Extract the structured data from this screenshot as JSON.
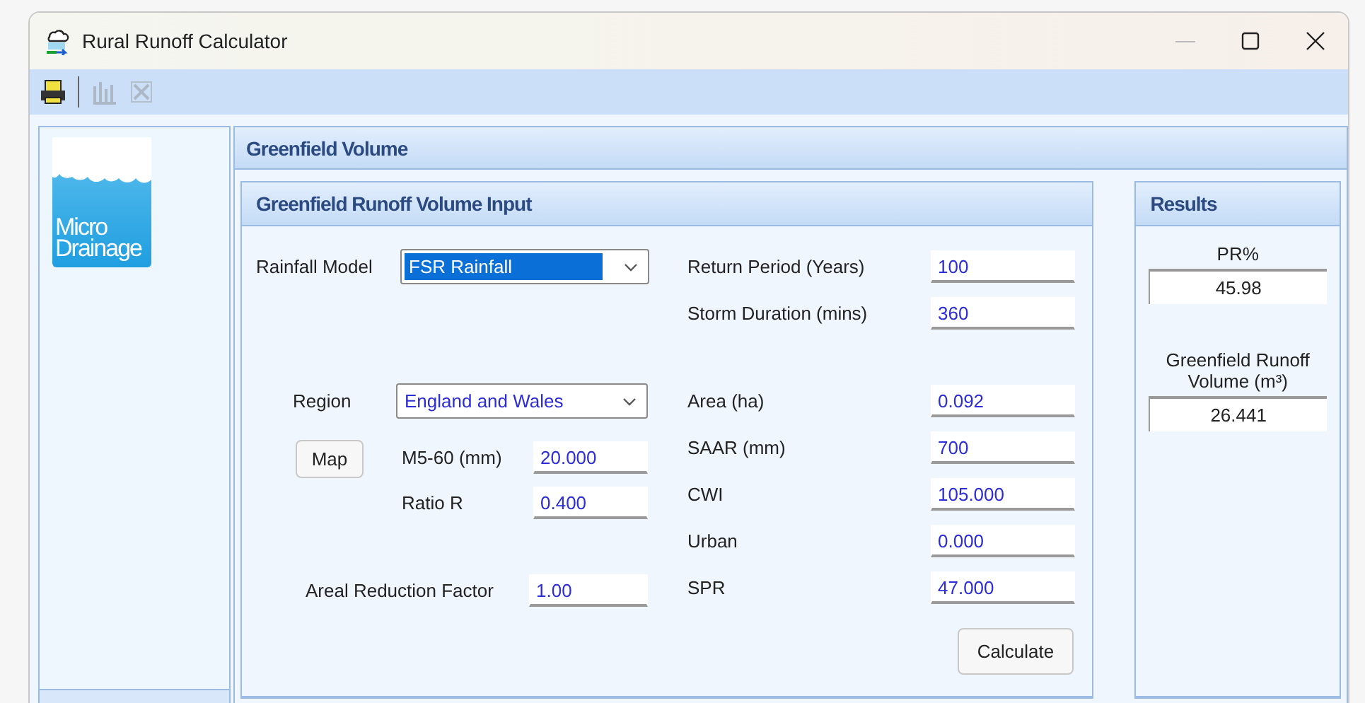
{
  "window": {
    "title": "Rural Runoff Calculator"
  },
  "toolbar": [
    {
      "kind": "printer",
      "disabled": false
    },
    {
      "kind": "chart",
      "disabled": true
    },
    {
      "kind": "delete",
      "disabled": true
    }
  ],
  "sidebar": {
    "logo_lines": [
      "Micro",
      "Drainage"
    ]
  },
  "section_title": "Greenfield Volume",
  "input_panel": {
    "title": "Greenfield Runoff Volume Input",
    "rainfall_model": {
      "label": "Rainfall Model",
      "value": "FSR Rainfall",
      "selected": true
    },
    "region": {
      "label": "Region",
      "value": "England and Wales",
      "selected": false
    },
    "map_button": "Map",
    "rainfall_fields": [
      {
        "label": "M5-60 (mm)",
        "value": "20.000"
      },
      {
        "label": "Ratio R",
        "value": "0.400"
      }
    ],
    "areal_reduction": {
      "label": "Areal Reduction Factor",
      "value": "1.00"
    },
    "storm_fields": [
      {
        "label": "Return Period (Years)",
        "value": "100"
      },
      {
        "label": "Storm Duration (mins)",
        "value": "360"
      }
    ],
    "catchment_fields": [
      {
        "label": "Area (ha)",
        "value": "0.092"
      },
      {
        "label": "SAAR (mm)",
        "value": "700"
      },
      {
        "label": "CWI",
        "value": "105.000"
      },
      {
        "label": "Urban",
        "value": "0.000"
      },
      {
        "label": "SPR",
        "value": "47.000"
      }
    ],
    "calculate_button": "Calculate"
  },
  "results": {
    "title": "Results",
    "items": [
      {
        "label": "PR%",
        "value": "45.98"
      },
      {
        "label": "Greenfield Runoff Volume (m³)",
        "value": "26.441"
      }
    ]
  }
}
